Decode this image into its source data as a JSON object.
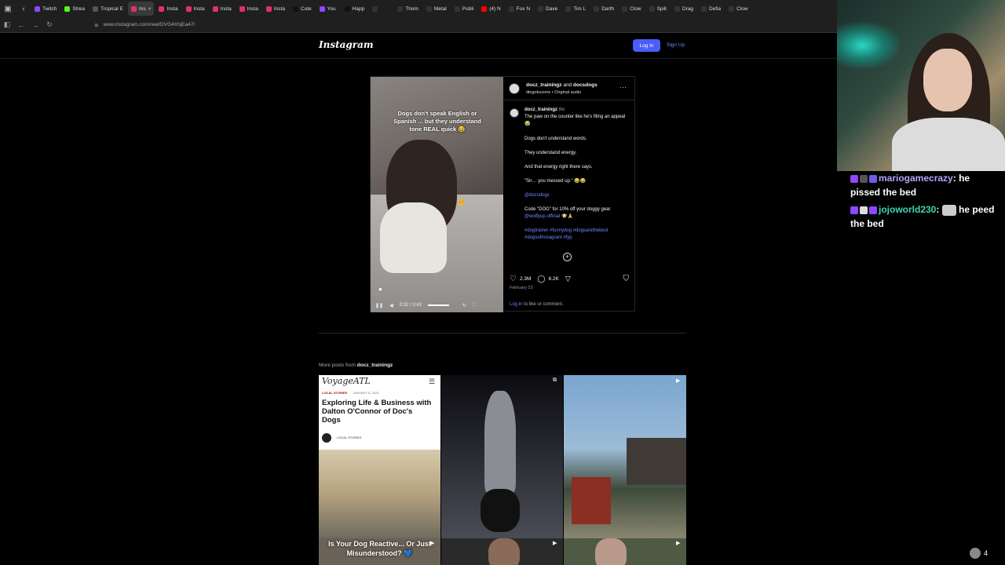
{
  "browser": {
    "tabs": [
      {
        "label": "Twitch",
        "color": "#9146ff"
      },
      {
        "label": "Strea",
        "color": "#53fc18"
      },
      {
        "label": "Tropical E",
        "color": "#555555"
      },
      {
        "label": "Ins",
        "color": "#e1306c",
        "active": true
      },
      {
        "label": "Insta",
        "color": "#e1306c"
      },
      {
        "label": "Insta",
        "color": "#e1306c"
      },
      {
        "label": "Insta",
        "color": "#e1306c"
      },
      {
        "label": "Insta",
        "color": "#e1306c"
      },
      {
        "label": "Insta",
        "color": "#e1306c"
      },
      {
        "label": "Cute",
        "color": "#111111"
      },
      {
        "label": "You",
        "color": "#9146ff"
      },
      {
        "label": "Happ",
        "color": "#111111"
      },
      {
        "label": "",
        "color": "#333333"
      },
      {
        "label": "Thom",
        "color": "#333333"
      },
      {
        "label": "Metal",
        "color": "#333333"
      },
      {
        "label": "Publi",
        "color": "#333333"
      },
      {
        "label": "(4) N",
        "color": "#ff0000"
      },
      {
        "label": "Fox N",
        "color": "#333333"
      },
      {
        "label": "Dave",
        "color": "#333333"
      },
      {
        "label": "Tim L",
        "color": "#333333"
      },
      {
        "label": "Darth",
        "color": "#333333"
      },
      {
        "label": "Clow",
        "color": "#333333"
      },
      {
        "label": "Spill",
        "color": "#333333"
      },
      {
        "label": "Drag",
        "color": "#333333"
      },
      {
        "label": "Defia",
        "color": "#333333"
      },
      {
        "label": "Clow",
        "color": "#333333"
      }
    ],
    "url": "www.instagram.com/reel/DVG4XhjEa47/"
  },
  "instagram": {
    "logo": "Instagram",
    "login_label": "Log In",
    "signup_label": "Sign Up",
    "post": {
      "video_caption": "Dogs don't speak English or Spanish ... but they understand tone REAL quick 😂",
      "time": "0:32 / 0:43",
      "progress": 0.74,
      "header_user1": "docz_trainingz",
      "header_and": "and",
      "header_user2": "docsdogs",
      "header_sub": "diegokozone • Original audio",
      "caption_user": "docz_trainingz",
      "caption_age": "8w",
      "caption_first": "The paw on the counter like he's filing an appeal 😭",
      "lines": [
        "Dogs don't understand words.",
        "They understand energy.",
        "And that energy right there says.",
        "\"Sir… you messed up.\" 😂😂"
      ],
      "mention": "@docsdogs",
      "code_text": "Code \"DOG\" for 10% off your doggy gear",
      "code_mention": "@wolfpup.official",
      "code_emoji": "🐶🙏",
      "hashtags": "#dogtrainer #funnydog #dogsarethebest #dogsofinstagram #fyp",
      "likes": "2.3M",
      "comments": "8.2K",
      "date": "February 23",
      "login_link": "Log in",
      "login_suffix": "to like or comment."
    },
    "more_posts_prefix": "More posts from",
    "more_posts_user": "docz_trainingz",
    "grid": {
      "article_brand": "VoyageATL",
      "article_tag": "LOCAL STORIES",
      "article_date": "JANUARY 8, 2025",
      "article_title": "Exploring Life & Business with Dalton O'Connor of Doc's Dogs",
      "article_footer": "LOCAL STORIES",
      "reel_caption": "Is Your Dog Reactive... Or Just Misunderstood? 💙"
    }
  },
  "stream": {
    "chat": [
      {
        "user": "mariogamecrazy",
        "user_color": "#b7a3ff",
        "text": "he pissed the bed"
      },
      {
        "user": "jojoworld230",
        "user_color": "#3fd6b0",
        "text": "he peed the bed"
      }
    ],
    "viewers": "4"
  }
}
